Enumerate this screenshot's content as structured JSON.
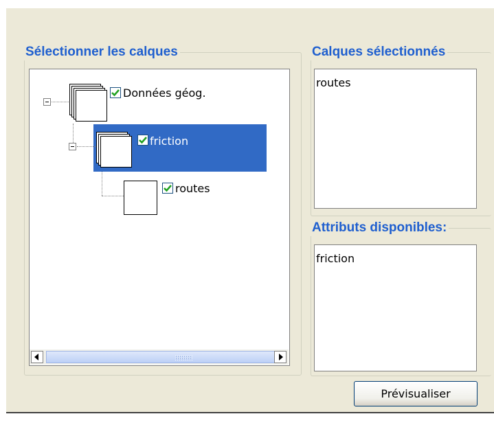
{
  "layers_group": {
    "title": "Sélectionner les calques",
    "tree": {
      "root": {
        "label": "Données géog.",
        "checked": true,
        "expanded": true
      },
      "child": {
        "label": "friction",
        "checked": true,
        "expanded": true,
        "selected": true
      },
      "leaf": {
        "label": "routes",
        "checked": true
      }
    }
  },
  "selected_layers_group": {
    "title": "Calques sélectionnés",
    "items": [
      "routes"
    ]
  },
  "attributes_group": {
    "title": "Attributs disponibles:",
    "items": [
      "friction"
    ]
  },
  "preview_button": {
    "label": "Prévisualiser"
  },
  "colors": {
    "legend": "#1f5fcf",
    "selection": "#316ac5",
    "panel": "#ece9d8"
  }
}
